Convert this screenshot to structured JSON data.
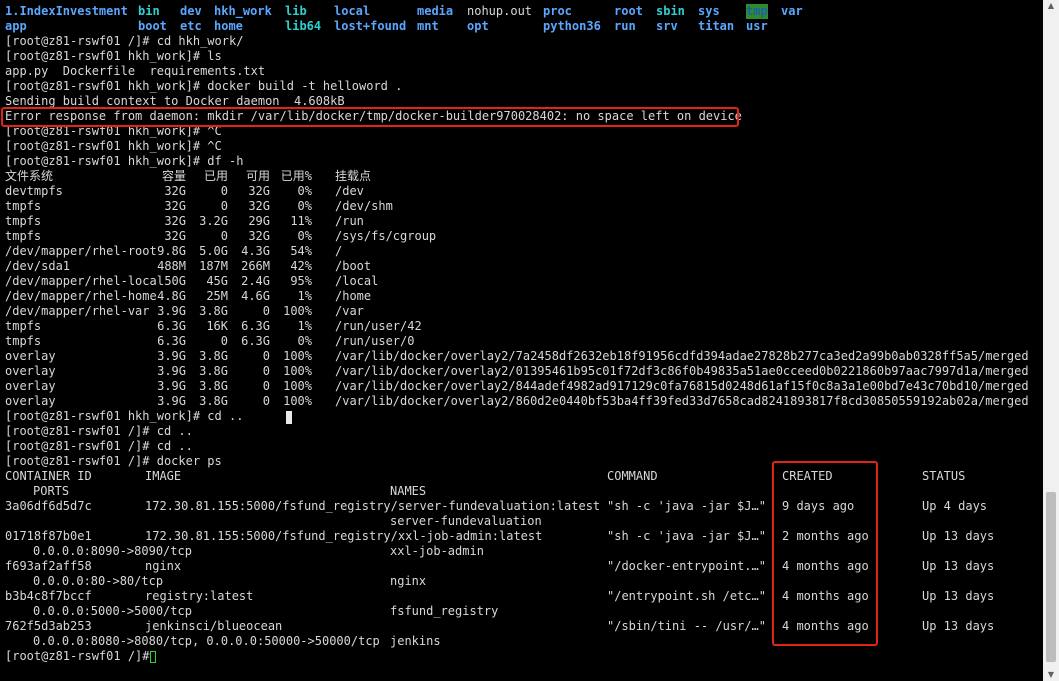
{
  "ls_root": {
    "row1": [
      {
        "name": "1.IndexInvestment",
        "style": "blue"
      },
      {
        "name": "bin",
        "style": "cyan"
      },
      {
        "name": "dev",
        "style": "blue"
      },
      {
        "name": "hkh_work",
        "style": "blue"
      },
      {
        "name": "lib",
        "style": "cyan"
      },
      {
        "name": "local",
        "style": "blue"
      },
      {
        "name": "media",
        "style": "blue"
      },
      {
        "name": "nohup.out",
        "style": "plain"
      },
      {
        "name": "proc",
        "style": "blue"
      },
      {
        "name": "root",
        "style": "blue"
      },
      {
        "name": "sbin",
        "style": "cyan"
      },
      {
        "name": "sys",
        "style": "blue"
      },
      {
        "name": "tmp",
        "style": "tmpdir"
      },
      {
        "name": "var",
        "style": "blue"
      }
    ],
    "row2": [
      {
        "name": "app",
        "style": "blue"
      },
      {
        "name": "boot",
        "style": "blue"
      },
      {
        "name": "etc",
        "style": "blue"
      },
      {
        "name": "home",
        "style": "blue"
      },
      {
        "name": "lib64",
        "style": "cyan"
      },
      {
        "name": "lost+found",
        "style": "blue"
      },
      {
        "name": "mnt",
        "style": "blue"
      },
      {
        "name": "opt",
        "style": "blue"
      },
      {
        "name": "python36",
        "style": "blue"
      },
      {
        "name": "run",
        "style": "blue"
      },
      {
        "name": "srv",
        "style": "blue"
      },
      {
        "name": "titan",
        "style": "blue"
      },
      {
        "name": "usr",
        "style": "blue"
      }
    ]
  },
  "session": [
    "[root@z81-rswf01 /]# cd hkh_work/",
    "[root@z81-rswf01 hkh_work]# ls",
    "app.py  Dockerfile  requirements.txt",
    "[root@z81-rswf01 hkh_work]# docker build -t helloword .",
    "Sending build context to Docker daemon  4.608kB",
    "Error response from daemon: mkdir /var/lib/docker/tmp/docker-builder970028402: no space left on device",
    "[root@z81-rswf01 hkh_work]# ^C",
    "[root@z81-rswf01 hkh_work]# ^C",
    "[root@z81-rswf01 hkh_work]# df -h"
  ],
  "df": {
    "headers": [
      "文件系统",
      "容量",
      "已用",
      "可用",
      "已用%",
      "挂载点"
    ],
    "rows": [
      [
        "devtmpfs",
        "32G",
        "0",
        "32G",
        "0%",
        "/dev"
      ],
      [
        "tmpfs",
        "32G",
        "0",
        "32G",
        "0%",
        "/dev/shm"
      ],
      [
        "tmpfs",
        "32G",
        "3.2G",
        "29G",
        "11%",
        "/run"
      ],
      [
        "tmpfs",
        "32G",
        "0",
        "32G",
        "0%",
        "/sys/fs/cgroup"
      ],
      [
        "/dev/mapper/rhel-root",
        "9.8G",
        "5.0G",
        "4.3G",
        "54%",
        "/"
      ],
      [
        "/dev/sda1",
        "488M",
        "187M",
        "266M",
        "42%",
        "/boot"
      ],
      [
        "/dev/mapper/rhel-local",
        "50G",
        "45G",
        "2.4G",
        "95%",
        "/local"
      ],
      [
        "/dev/mapper/rhel-home",
        "4.8G",
        "25M",
        "4.6G",
        "1%",
        "/home"
      ],
      [
        "/dev/mapper/rhel-var",
        "3.9G",
        "3.8G",
        "0",
        "100%",
        "/var"
      ],
      [
        "tmpfs",
        "6.3G",
        "16K",
        "6.3G",
        "1%",
        "/run/user/42"
      ],
      [
        "tmpfs",
        "6.3G",
        "0",
        "6.3G",
        "0%",
        "/run/user/0"
      ],
      [
        "overlay",
        "3.9G",
        "3.8G",
        "0",
        "100%",
        "/var/lib/docker/overlay2/7a2458df2632eb18f91956cdfd394adae27828b277ca3ed2a99b0ab0328ff5a5/merged"
      ],
      [
        "overlay",
        "3.9G",
        "3.8G",
        "0",
        "100%",
        "/var/lib/docker/overlay2/01395461b95c01f72df3c86f0b49835a51ae0cceed0b0221860b97aac7997d1a/merged"
      ],
      [
        "overlay",
        "3.9G",
        "3.8G",
        "0",
        "100%",
        "/var/lib/docker/overlay2/844adef4982ad917129c0fa76815d0248d61af15f0c8a3a1e00bd7e43c70bd10/merged"
      ],
      [
        "overlay",
        "3.9G",
        "3.8G",
        "0",
        "100%",
        "/var/lib/docker/overlay2/860d2e0440bf53ba4ff39fed33d7658cad8241893817f8cd30850559192ab02a/merged"
      ]
    ]
  },
  "session2": [
    "[root@z81-rswf01 hkh_work]# cd ..",
    "[root@z81-rswf01 /]# cd ..",
    "[root@z81-rswf01 /]# cd ..",
    "[root@z81-rswf01 /]# docker ps"
  ],
  "docker_ps": {
    "headers": {
      "container_id": "CONTAINER ID",
      "image": "IMAGE",
      "command": "COMMAND",
      "created": "CREATED",
      "status": "STATUS",
      "ports": "PORTS",
      "names": "NAMES"
    },
    "rows": [
      {
        "id": "3a06df6d5d7c",
        "image": "172.30.81.155:5000/fsfund_registry/server-fundevaluation:latest",
        "command": "\"sh -c 'java -jar $J…\"",
        "created": "9 days ago",
        "status": "Up 4 days",
        "ports": "",
        "names": "server-fundevaluation"
      },
      {
        "id": "01718f87b0e1",
        "image": "172.30.81.155:5000/fsfund_registry/xxl-job-admin:latest",
        "command": "\"sh -c 'java -jar $J…\"",
        "created": "2 months ago",
        "status": "Up 13 days",
        "ports": "0.0.0.0:8090->8090/tcp",
        "names": "xxl-job-admin"
      },
      {
        "id": "f693af2aff58",
        "image": "nginx",
        "command": "\"/docker-entrypoint.…\"",
        "created": "4 months ago",
        "status": "Up 13 days",
        "ports": "0.0.0.0:80->80/tcp",
        "names": "nginx"
      },
      {
        "id": "b3b4c8f7bccf",
        "image": "registry:latest",
        "command": "\"/entrypoint.sh /etc…\"",
        "created": "4 months ago",
        "status": "Up 13 days",
        "ports": "0.0.0.0:5000->5000/tcp",
        "names": "fsfund_registry"
      },
      {
        "id": "762f5d3ab253",
        "image": "jenkinsci/blueocean",
        "command": "\"/sbin/tini -- /usr/…\"",
        "created": "4 months ago",
        "status": "Up 13 days",
        "ports": "0.0.0.0:8080->8080/tcp, 0.0.0.0:50000->50000/tcp",
        "names": "jenkins"
      }
    ]
  },
  "final_prompt": "[root@z81-rswf01 /]# ",
  "colors": {
    "background": "#000000",
    "text": "#d8d8d8",
    "directory": "#5aa7ff",
    "symlink": "#2fd0d0",
    "highlight_border": "#e0241a",
    "sticky_dir_bg": "#2e8b2e"
  }
}
